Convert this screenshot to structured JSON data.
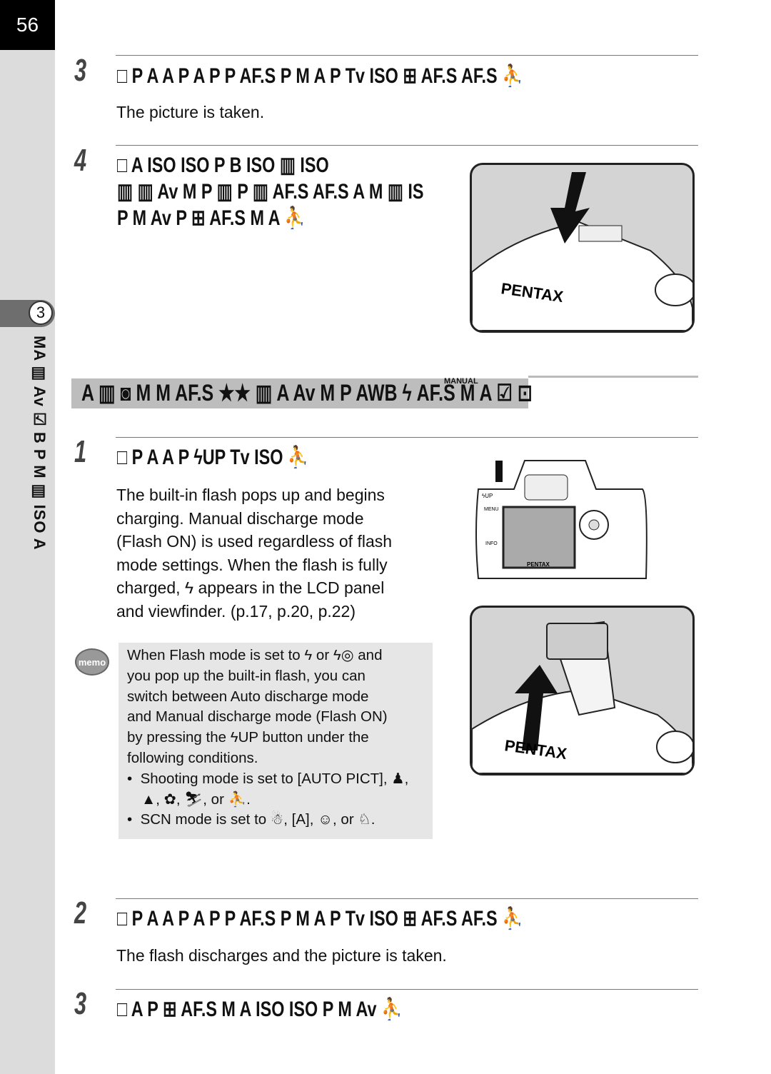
{
  "page_number": "56",
  "chapter": {
    "number": "3",
    "side_label": "MA ▥ Av ☑ B P M ▥ ISO A"
  },
  "steps_top": [
    {
      "number": "3",
      "heading": "□ P A A P A P P AF.S P M A P Tv ISO ⊞ AF.S AF.S ⛹",
      "body": "The picture is taken."
    },
    {
      "number": "4",
      "heading_lines": [
        "□ A ISO ISO P B ISO ▥ ISO",
        "▥ ▥ Av M P ▥ P ▥ AF.S AF.S A M ▥ IS",
        "P M Av P ⊞ AF.S M A ⛹"
      ]
    }
  ],
  "section_banner": "A ▥ ◙ M M AF.S ★★ ▥ A Av M P AWB ϟ AF.S M A ☑ ⊡",
  "section_banner_superscript": "MANUAL",
  "step1": {
    "number": "1",
    "heading": "□ P A A P ϟUP Tv ISO ⛹",
    "body_lines": [
      "The built-in flash pops up and begins",
      "charging. Manual discharge mode",
      "(Flash ON) is used regardless of flash",
      "mode settings. When the flash is fully",
      "charged, ϟ appears in the LCD panel",
      "and viewfinder. (p.17, p.20, p.22)"
    ]
  },
  "memo": {
    "icon_label": "memo",
    "lines": [
      "When Flash mode is set to ϟ or ϟ◎ and",
      "you pop up the built-in flash, you can",
      "switch between Auto discharge mode",
      "and Manual discharge mode (Flash ON)",
      "by pressing the ϟUP button under the",
      "following conditions."
    ],
    "bullets": [
      "Shooting mode is set to [AUTO PICT], ♟, ▲, ✿, ⛷, or ⛹.",
      "SCN mode is set to ☃, [A], ☺, or ♘."
    ]
  },
  "steps_bottom": [
    {
      "number": "2",
      "heading": "□ P A A P A P P AF.S P M A P Tv ISO ⊞ AF.S AF.S ⛹",
      "body": "The flash discharges and the picture is taken."
    },
    {
      "number": "3",
      "heading": "□ A P ⊞ AF.S M A ISO ISO P M Av ⛹"
    }
  ],
  "illustration_labels": {
    "brand": "PENTAX",
    "flash_up": "ϟUP",
    "menu": "MENU",
    "info": "INFO"
  }
}
